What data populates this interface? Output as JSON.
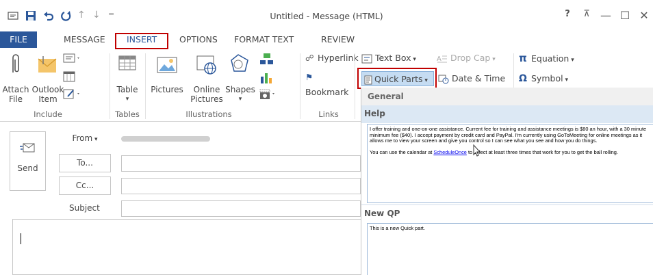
{
  "window": {
    "title": "Untitled - Message (HTML)",
    "help_glyph": "?",
    "ribbon_display_glyph": "⊼",
    "minimize_glyph": "—",
    "maximize_glyph": "☐",
    "close_glyph": "✕"
  },
  "tabs": [
    "FILE",
    "MESSAGE",
    "INSERT",
    "OPTIONS",
    "FORMAT TEXT",
    "REVIEW"
  ],
  "ribbon": {
    "include": {
      "label": "Include",
      "attach_file": [
        "Attach",
        "File"
      ],
      "outlook_item": [
        "Outlook",
        "Item"
      ]
    },
    "tables": {
      "label": "Tables",
      "table": "Table"
    },
    "illustrations": {
      "label": "Illustrations",
      "pictures": "Pictures",
      "online_pictures": [
        "Online",
        "Pictures"
      ],
      "shapes": "Shapes"
    },
    "links": {
      "label": "Links",
      "hyperlink": "Hyperlink",
      "bookmark": "Bookmark"
    },
    "text": {
      "text_box": "Text Box",
      "drop_cap": "Drop Cap",
      "quick_parts": "Quick Parts",
      "date_time": "Date & Time"
    },
    "symbols": {
      "equation": "Equation",
      "symbol": "Symbol"
    }
  },
  "quick_parts_menu": {
    "section": "General",
    "entries": [
      {
        "title": "Help",
        "paragraphs": [
          "I offer training and one-on-one assistance. Current fee for training and assistance meetings is $80 an hour, with a 30 minute minimum fee ($40). I accept payment by credit card and PayPal. I'm currently using GoToMeeting for online meetings as it allows me to view your screen and give you control so I can see what you see and how you do things.",
          "You can use the calendar at ",
          "ScheduleOnce",
          " to select at least three times that work for you to get the ball rolling."
        ]
      },
      {
        "title": "New QP",
        "paragraphs": [
          "This is a new Quick part."
        ]
      }
    ]
  },
  "compose": {
    "send": "Send",
    "from": "From",
    "to": "To...",
    "cc": "Cc...",
    "subject": "Subject",
    "from_value": "",
    "to_value": "",
    "cc_value": "",
    "subject_value": ""
  },
  "colors": {
    "file_tab": "#2b579a",
    "highlight": "#c00000",
    "gallery_title": "#dce8f4",
    "accent_icon": "#2b579a"
  }
}
